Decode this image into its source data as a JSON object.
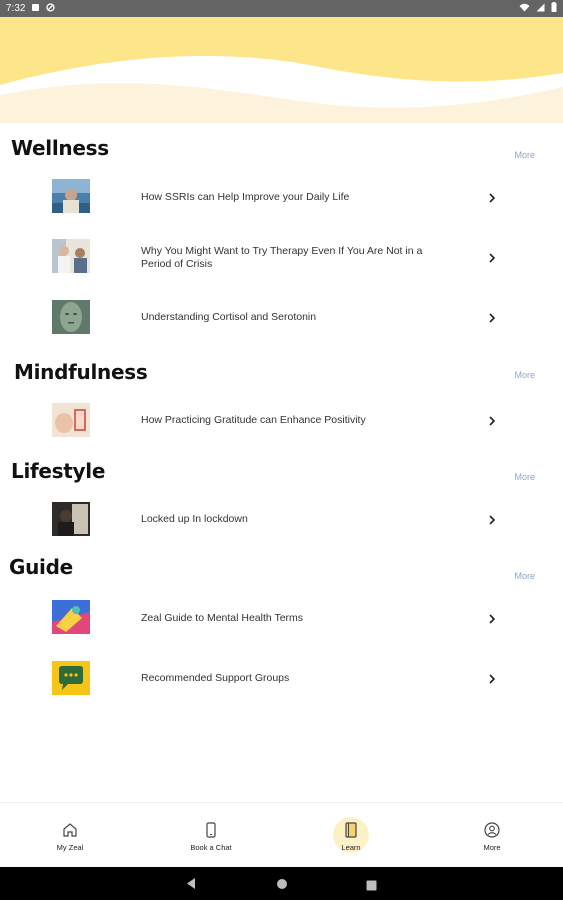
{
  "status_bar": {
    "time": "7:32"
  },
  "colors": {
    "header_yellow": "#fde68a",
    "header_cream": "#fdf3dc",
    "more_link": "#8aa6c8",
    "active_nav": "#fdf1c7"
  },
  "sections": [
    {
      "title": "Wellness",
      "more": "More",
      "items": [
        {
          "label": "How SSRIs can Help Improve your Daily Life"
        },
        {
          "label": "Why You Might Want to Try Therapy Even If You Are Not in a Period of Crisis"
        },
        {
          "label": "Understanding Cortisol and Serotonin"
        }
      ]
    },
    {
      "title": "Mindfulness",
      "more": "More",
      "items": [
        {
          "label": "How Practicing Gratitude can Enhance Positivity"
        }
      ]
    },
    {
      "title": "Lifestyle",
      "more": "More",
      "items": [
        {
          "label": "Locked up In lockdown"
        }
      ]
    },
    {
      "title": "Guide",
      "more": "More",
      "items": [
        {
          "label": "Zeal Guide to Mental Health Terms"
        },
        {
          "label": "Recommended Support Groups"
        }
      ]
    }
  ],
  "bottom_nav": [
    {
      "label": "My Zeal",
      "icon": "home-icon"
    },
    {
      "label": "Book a Chat",
      "icon": "phone-icon"
    },
    {
      "label": "Learn",
      "icon": "book-icon",
      "active": true
    },
    {
      "label": "More",
      "icon": "profile-icon"
    }
  ]
}
